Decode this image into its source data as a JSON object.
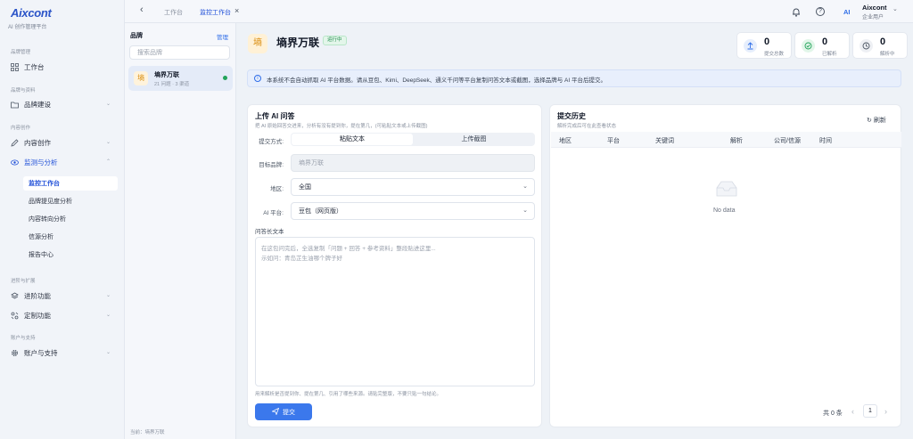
{
  "app": {
    "logo": "Aixcont",
    "subtitle": "AI 创作管理平台"
  },
  "sidebar": {
    "sections": [
      "品牌管理",
      "品牌与资料",
      "内容创作",
      "进阶与扩展",
      "账户与支持"
    ],
    "items": [
      {
        "label": "工作台",
        "icon": "grid-icon"
      },
      {
        "label": "品牌建设",
        "icon": "folder-icon"
      },
      {
        "label": "内容创作",
        "icon": "pen-icon"
      },
      {
        "label": "监测与分析",
        "icon": "eye-icon"
      },
      {
        "label": "进阶功能",
        "icon": "layers-icon"
      },
      {
        "label": "定制功能",
        "icon": "puzzle-icon"
      },
      {
        "label": "账户与支持",
        "icon": "gear-icon"
      }
    ],
    "subitems": [
      "监控工作台",
      "品牌提见度分析",
      "内容转向分析",
      "信源分析",
      "报告中心"
    ]
  },
  "topbar": {
    "back": "‹",
    "tab1": "工作台",
    "tab2": "监控工作台",
    "close": "×",
    "ai_badge": "AI",
    "user_name": "Aixcont",
    "user_role": "企业用户"
  },
  "brands": {
    "title": "品牌",
    "manage": "管理",
    "search_placeholder": "搜索品牌",
    "item": {
      "avatar": "墒",
      "name": "墒界万联",
      "meta": "21 问题 · 3 渠道"
    },
    "footer": "当前：墒界万联"
  },
  "header": {
    "avatar": "墒",
    "title": "墒界万联",
    "status": "运行中"
  },
  "stats": [
    {
      "value": "0",
      "label": "提交总数"
    },
    {
      "value": "0",
      "label": "已解析"
    },
    {
      "value": "0",
      "label": "解析中"
    }
  ],
  "notice": "本系统不会自动抓取 AI 平台数据。请从豆包、Kimi、DeepSeek、通义千问等平台复制问答文本或截图，选择品牌与 AI 平台后提交。",
  "upload": {
    "title": "上传 AI 问答",
    "desc": "把 AI 原始回答交进来，分析有没有提到你，提在第几，(可粘贴文本或上传截图)",
    "method_label": "提交方式:",
    "method_paste": "粘贴文本",
    "method_upload": "上传截图",
    "brand_label": "目标品牌:",
    "brand_value": "墒界万联",
    "region_label": "地区:",
    "region_value": "全国",
    "platform_label": "AI 平台:",
    "platform_value": "豆包（网页版）",
    "text_label": "问答长文本",
    "text_placeholder_1": "在这包问完后，全选复制「问题 + 回答 + 参考资料」整段贴进这里...",
    "text_placeholder_2": "示如问：青岛芷生油哪个牌子好",
    "hint": "用来解析是否提到你、提在第几、引用了哪些来源。请贴完整版，不要只贴一句结论。",
    "submit": "提交"
  },
  "history": {
    "title": "提交历史",
    "desc": "解析完成后可在此查看状态",
    "refresh": "刷新",
    "columns": [
      "地区",
      "平台",
      "关键词",
      "解析",
      "公司/信源",
      "时间"
    ],
    "empty": "No data",
    "total": "共 0 条",
    "page": "1",
    "prev": "‹",
    "next": "›"
  },
  "colors": {
    "accent": "#2f6ee8",
    "active": "#1f4fd8",
    "status_green": "#22a35a",
    "brand_orange": "#f4a025"
  }
}
